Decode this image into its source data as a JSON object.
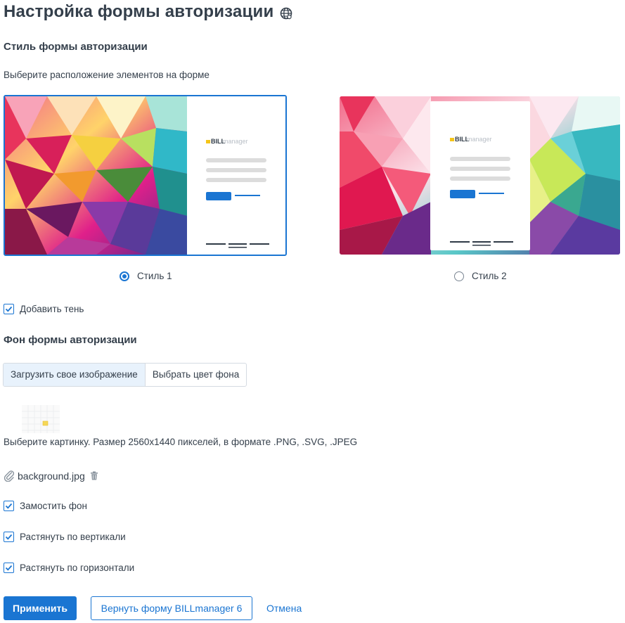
{
  "page": {
    "title": "Настройка формы авторизации",
    "title_icon": "globe-icon"
  },
  "style_section": {
    "heading": "Стиль формы авторизации",
    "hint": "Выберите расположение элементов на форме",
    "options": [
      {
        "label": "Стиль 1",
        "selected": true
      },
      {
        "label": "Стиль 2",
        "selected": false
      }
    ],
    "preview_logo_bold": "BILL",
    "preview_logo_light": "manager"
  },
  "shadow": {
    "label": "Добавить тень",
    "checked": true
  },
  "background_section": {
    "heading": "Фон формы авторизации",
    "tabs": [
      {
        "label": "Загрузить свое изображение",
        "active": true
      },
      {
        "label": "Выбрать цвет фона",
        "active": false
      }
    ],
    "hint": "Выберите картинку. Размер 2560x1440 пикселей, в формате .PNG, .SVG, .JPEG",
    "file_name": "background.jpg",
    "options": [
      {
        "label": "Замостить фон",
        "checked": true
      },
      {
        "label": "Растянуть по вертикали",
        "checked": true
      },
      {
        "label": "Растянуть по горизонтали",
        "checked": true
      }
    ]
  },
  "actions": {
    "apply": "Применить",
    "reset": "Вернуть форму BILLmanager 6",
    "cancel": "Отмена"
  },
  "colors": {
    "accent": "#1a75d2",
    "text": "#343f4b",
    "logo_yellow": "#f5c518"
  }
}
